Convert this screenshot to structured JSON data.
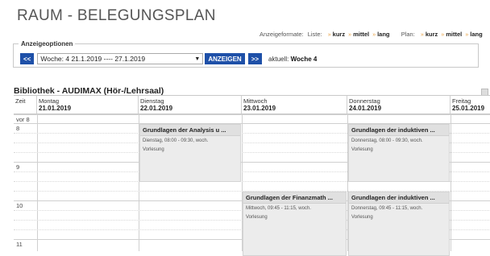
{
  "page": {
    "title": "RAUM - BELEGUNGSPLAN",
    "formats": {
      "label": "Anzeigeformate:",
      "list_label": "Liste:",
      "plan_label": "Plan:",
      "options": [
        "kurz",
        "mittel",
        "lang"
      ],
      "separator": "»"
    }
  },
  "options": {
    "legend": "Anzeigeoptionen",
    "prev_label": "<<",
    "week_value": "Woche: 4    21.1.2019 ---- 27.1.2019",
    "show_label": "ANZEIGEN",
    "next_label": ">>",
    "current_prefix": "aktuell:",
    "current_value": "Woche 4"
  },
  "room": {
    "name": "Bibliothek - AUDIMAX (Hör-/Lehrsaal)"
  },
  "schedule": {
    "time_header": "Zeit",
    "days": [
      {
        "name": "Montag",
        "date": "21.01.2019"
      },
      {
        "name": "Dienstag",
        "date": "22.01.2019"
      },
      {
        "name": "Mittwoch",
        "date": "23.01.2019"
      },
      {
        "name": "Donnerstag",
        "date": "24.01.2019"
      },
      {
        "name": "Freitag",
        "date": "25.01.2019"
      }
    ],
    "hour_labels": [
      "vor 8",
      "8",
      "9",
      "10",
      "11"
    ],
    "events": [
      {
        "title": "Grundlagen der Analysis u ...",
        "detail": "Dienstag, 08:00 - 09:30, woch.",
        "type": "Vorlesung"
      },
      {
        "title": "Grundlagen der induktiven ...",
        "detail": "Donnerstag, 08:00 - 09:30, woch.",
        "type": "Vorlesung"
      },
      {
        "title": "Grundlagen der Finanzmath ...",
        "detail": "Mittwoch, 09:45 - 11:15, woch.",
        "type": "Vorlesung"
      },
      {
        "title": "Grundlagen der induktiven ...",
        "detail": "Donnerstag, 09:45 - 11:15, woch.",
        "type": "Vorlesung"
      }
    ]
  }
}
